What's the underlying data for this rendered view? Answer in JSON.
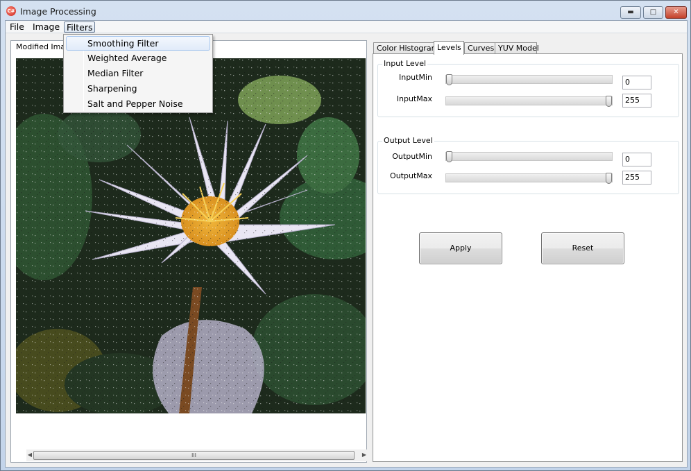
{
  "window": {
    "title": "Image Processing",
    "icon": "app-icon",
    "controls": [
      "minimize-icon",
      "maximize-icon",
      "close-icon"
    ]
  },
  "menu": {
    "file": "File",
    "image": "Image",
    "filters": "Filters"
  },
  "filters_menu": [
    "Smoothing Filter",
    "Weighted Average",
    "Median Filter",
    "Sharpening",
    "Salt and Pepper Noise"
  ],
  "left_panel": {
    "caption": "Modified Image",
    "scroll_grip": "III"
  },
  "tabs": [
    "Color Histogram",
    "Levels",
    "Curves",
    "YUV Model"
  ],
  "active_tab": "Levels",
  "input_level": {
    "title": "Input Level",
    "min_label": "InputMin",
    "max_label": "InputMax",
    "min_value": "0",
    "max_value": "255",
    "min_slider": 0,
    "max_slider": 255
  },
  "output_level": {
    "title": "Output Level",
    "min_label": "OutputMin",
    "max_label": "OutputMax",
    "min_value": "0",
    "max_value": "255",
    "min_slider": 0,
    "max_slider": 255
  },
  "buttons": {
    "apply": "Apply",
    "reset": "Reset"
  }
}
